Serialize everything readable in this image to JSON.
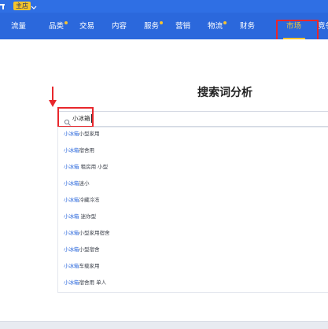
{
  "header": {
    "store_badge": "主店"
  },
  "nav": {
    "items": [
      {
        "label": "流量",
        "dot": false
      },
      {
        "label": "品类",
        "dot": true
      },
      {
        "label": "交易",
        "dot": false
      },
      {
        "label": "内容",
        "dot": false
      },
      {
        "label": "服务",
        "dot": true
      },
      {
        "label": "营销",
        "dot": false
      },
      {
        "label": "物流",
        "dot": true
      },
      {
        "label": "财务",
        "dot": false
      },
      {
        "label": "市场",
        "dot": false
      },
      {
        "label": "竞争",
        "dot": false
      }
    ],
    "active": "市场"
  },
  "main": {
    "title": "搜索词分析",
    "search": {
      "value": "小冰箱"
    },
    "suggestions": [
      {
        "hl": "小冰箱",
        "rest": "小型家用"
      },
      {
        "hl": "小冰箱",
        "rest": "宿舍用"
      },
      {
        "hl": "小冰箱",
        "rest": " 租房用 小型"
      },
      {
        "hl": "小冰箱",
        "rest": "迷小"
      },
      {
        "hl": "小冰箱",
        "rest": "冷藏冷冻"
      },
      {
        "hl": "小冰箱",
        "rest": " 迷你型"
      },
      {
        "hl": "小冰箱",
        "rest": "小型家用宿舍"
      },
      {
        "hl": "小冰箱",
        "rest": "小型宿舍"
      },
      {
        "hl": "小冰箱",
        "rest": "车载家用"
      },
      {
        "hl": "小冰箱",
        "rest": "宿舍用 单人"
      }
    ]
  },
  "colors": {
    "nav_bg": "#2b68dc",
    "accent": "#f5c332",
    "annotation": "#e8272c"
  }
}
